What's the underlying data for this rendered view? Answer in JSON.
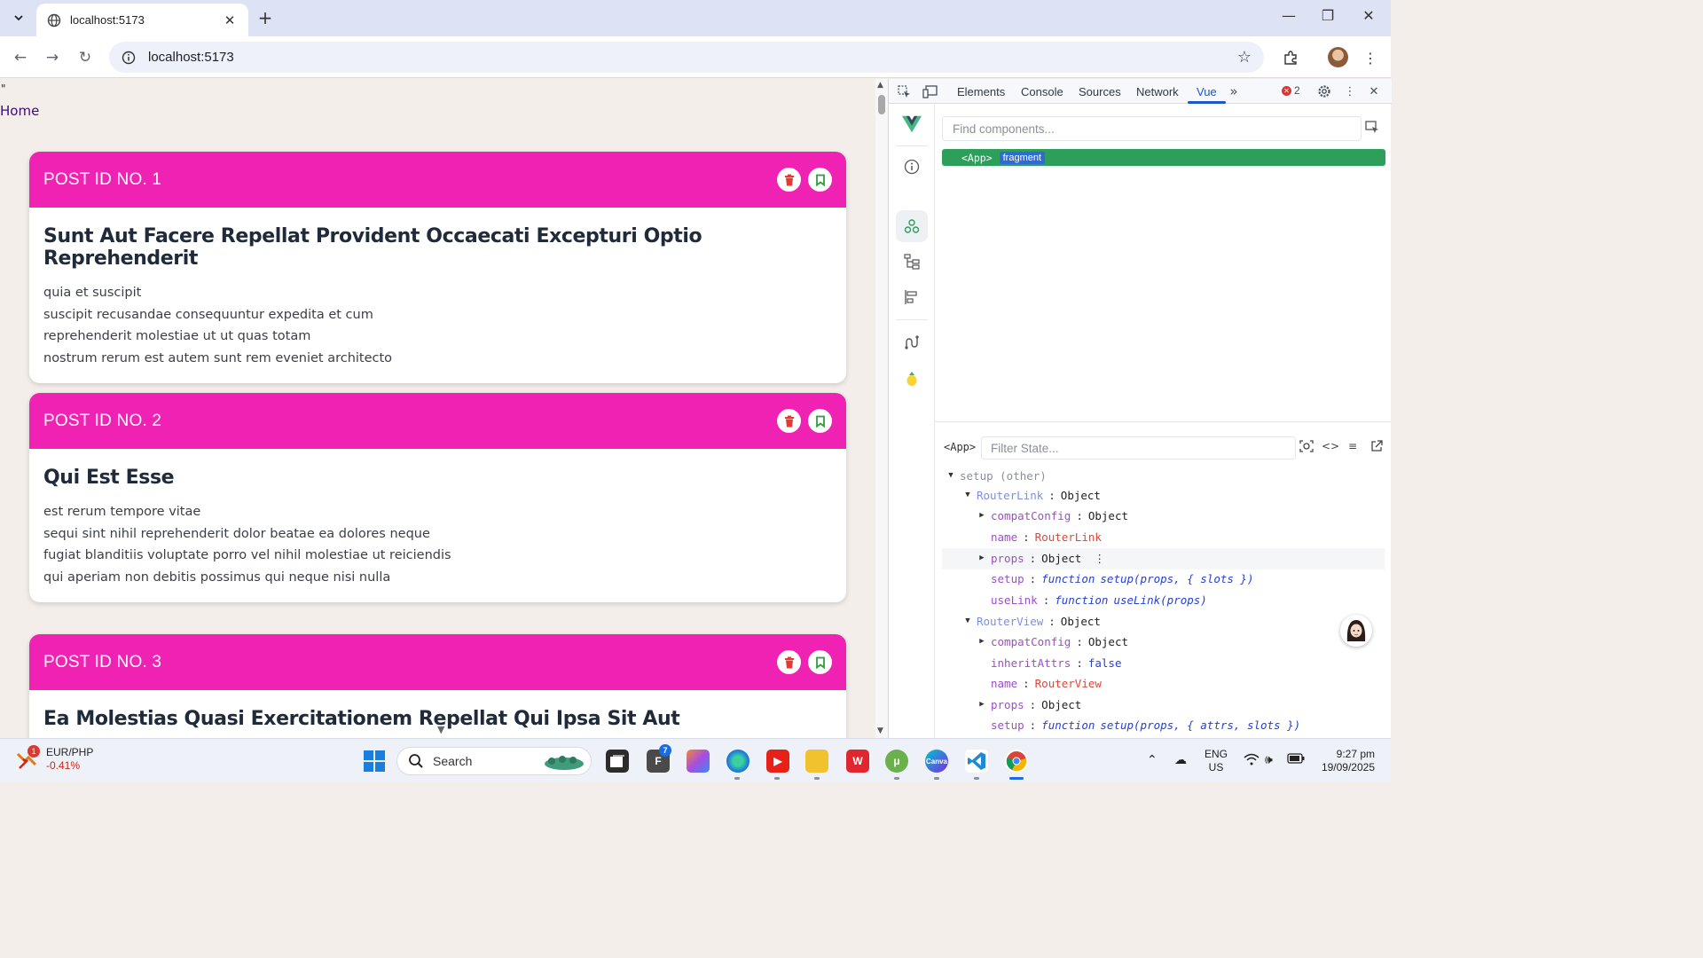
{
  "browser": {
    "tab_title": "localhost:5173",
    "url": "localhost:5173"
  },
  "page": {
    "stray_quote": "\"",
    "home_link": "Home",
    "posts": [
      {
        "id_label": "POST ID NO. 1",
        "title": "Sunt Aut Facere Repellat Provident Occaecati Excepturi Optio Reprehenderit",
        "lines": [
          "quia et suscipit",
          "suscipit recusandae consequuntur expedita et cum",
          "reprehenderit molestiae ut ut quas totam",
          "nostrum rerum est autem sunt rem eveniet architecto"
        ]
      },
      {
        "id_label": "POST ID NO. 2",
        "title": "Qui Est Esse",
        "lines": [
          "est rerum tempore vitae",
          "sequi sint nihil reprehenderit dolor beatae ea dolores neque",
          "fugiat blanditiis voluptate porro vel nihil molestiae ut reiciendis",
          "qui aperiam non debitis possimus qui neque nisi nulla"
        ]
      },
      {
        "id_label": "POST ID NO. 3",
        "title": "Ea Molestias Quasi Exercitationem Repellat Qui Ipsa Sit Aut",
        "lines": []
      }
    ],
    "colors": {
      "header_pink": "#f022b4",
      "delete_red": "#e53935",
      "bookmark_green": "#2e9e3a"
    }
  },
  "devtools": {
    "tabs": [
      "Elements",
      "Console",
      "Sources",
      "Network",
      "Vue"
    ],
    "active_tab": "Vue",
    "error_count": "2",
    "find_placeholder": "Find components...",
    "component_tag": "<App>",
    "component_badge": "fragment",
    "state_tag": "<App>",
    "filter_placeholder": "Filter State...",
    "tree": {
      "setup_label": "setup (other)",
      "router_link": {
        "key": "RouterLink",
        "type": "Object"
      },
      "router_link_children": [
        {
          "key": "compatConfig",
          "value": "Object",
          "expandable": true
        },
        {
          "key": "name",
          "value": "RouterLink",
          "kind": "str"
        },
        {
          "key": "props",
          "value": "Object",
          "expandable": true
        },
        {
          "key": "setup",
          "fn_kw": "function",
          "fn_sig": "setup(props, { slots })"
        },
        {
          "key": "useLink",
          "fn_kw": "function",
          "fn_sig": "useLink(props)"
        }
      ],
      "router_view": {
        "key": "RouterView",
        "type": "Object"
      },
      "router_view_children": [
        {
          "key": "compatConfig",
          "value": "Object",
          "expandable": true
        },
        {
          "key": "inheritAttrs",
          "value": "false",
          "kind": "bool"
        },
        {
          "key": "name",
          "value": "RouterView",
          "kind": "str"
        },
        {
          "key": "props",
          "value": "Object",
          "expandable": true
        },
        {
          "key": "setup",
          "fn_kw": "function",
          "fn_sig": "setup(props, { attrs, slots })"
        }
      ]
    }
  },
  "taskbar": {
    "stock_badge": "1",
    "stock_pair": "EUR/PHP",
    "stock_change": "-0.41%",
    "search_label": "Search",
    "app_badge": "7",
    "lang_top": "ENG",
    "lang_bottom": "US",
    "time": "9:27 pm",
    "date": "19/09/2025"
  }
}
